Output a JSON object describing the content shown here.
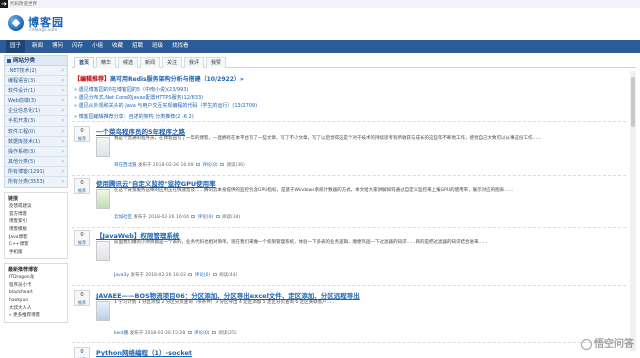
{
  "top": {
    "tagline": "代码改变世界"
  },
  "logo": {
    "name": "博客园",
    "domain": "cnblogs.com"
  },
  "nav": [
    "园子",
    "新闻",
    "博问",
    "闪存",
    "小组",
    "收藏",
    "招聘",
    "班级",
    "找找看"
  ],
  "sidebar": {
    "title": "网站分类",
    "categories": [
      ".NET技术(2)",
      "编程语言(3)",
      "软件设计(1)",
      "Web前端(3)",
      "企业信息化(1)",
      "手机开发(3)",
      "软件工程(0)",
      "数据库技术(1)",
      "操作系统(3)",
      "其他分类(5)",
      "所有博客(1291)",
      "所有分类(3553)"
    ],
    "links_title": "链接",
    "links": [
      "反馈或建议",
      "官方博客",
      "博客索引",
      "博客模板",
      "Java博客",
      "C++博客",
      "手机版"
    ],
    "recommend_title": "最新推荐博客",
    "recommend": [
      "ITDragon龙",
      "程序员小卡",
      "blackheart",
      "haokyun",
      "大叔大人人",
      "» 更多推荐博客"
    ]
  },
  "tabs": [
    "首页",
    "精华",
    "候选",
    "新闻",
    "关注",
    "我评",
    "我赞"
  ],
  "notice": {
    "headline_tag": "【编辑推荐】",
    "headline_text": "高可用Redis服务架构分析与搭建（10/2922）»",
    "lines": [
      "» 遇见博客园的0在博客园的5（中南小说)(23/993)",
      "» 遇见分布式.Net Core的javax配置HTTPS服务(12/633)",
      "» 遇见从外观和关头的 Java 与用户交互实现编程的代码（学生的运行）(13/2709)"
    ],
    "more": "» 博客园编辑推荐分享：自述的架构 分类推荐(2 -6 2)"
  },
  "posts": [
    {
      "digg": "0",
      "digg_label": "推荐",
      "title": "一个菜鸟程序员的5年程序之路",
      "summary": "我是个普通的程序员，在博客园写了一年的博客，一直拥有在本平台写了一些文章，写了不少文章，写了以后觉得这是个对于技术的持续思考有所收获与成长的这些年不断地工作，感觉自己大致可以从事这份工作……",
      "author": "哥在西北狼",
      "date": "2018-02-26 16:09",
      "comments": "评论(0)",
      "reads": "阅读(36)"
    },
    {
      "digg": "0",
      "digg_label": "推荐",
      "title": "使用腾讯云\"自定义监控\"监控GPU使用率",
      "summary": "在这个背景服务这样的应用正在快速普及……腾讯云本身提供的监控包含GPU指标，是基于Windows系统计数器的方式，本文给大家讲解如何通过自定义监控来上报GPU的使用率，展示对应的图表……",
      "author": "云加社区",
      "date": "2018-02-26 16:04",
      "comments": "评论(0)",
      "reads": "阅读(34)"
    },
    {
      "digg": "0",
      "digg_label": "推荐",
      "title": "【JavaWeb】权限管理系统",
      "summary": "前面我们做的小项目都是一个表的，业务代码也相对简单。现在我们来做一个权限管理系统，体验一下多表的业务逻辑，顺便巩固一下过滤器的知识……目的是把过滤器的知识结合进来……",
      "author": "Java3y",
      "date": "2018-02-26 16:02",
      "comments": "评论(0)",
      "reads": "阅读(44)"
    },
    {
      "digg": "0",
      "digg_label": "推荐",
      "title": "JAVAEE——BOS物流项目06：分区添加、分区导出excel文件、定区添加、分区远程导出",
      "summary": "1 学习计划 1 分区添加 2 分区分页查询（带条件）3 分区导出 4 定区添加 5 定区分页查询 6 定区关联客户……",
      "author": "kent鹏",
      "date": "2018-02-26 15:28",
      "comments": "评论(0)",
      "reads": "阅读(25)"
    },
    {
      "digg": "0",
      "digg_label": "推荐",
      "title": "Python网络编程（1）-socket",
      "summary": "",
      "author": "",
      "date": "",
      "comments": "",
      "reads": ""
    }
  ],
  "watermark": "悟空问答"
}
